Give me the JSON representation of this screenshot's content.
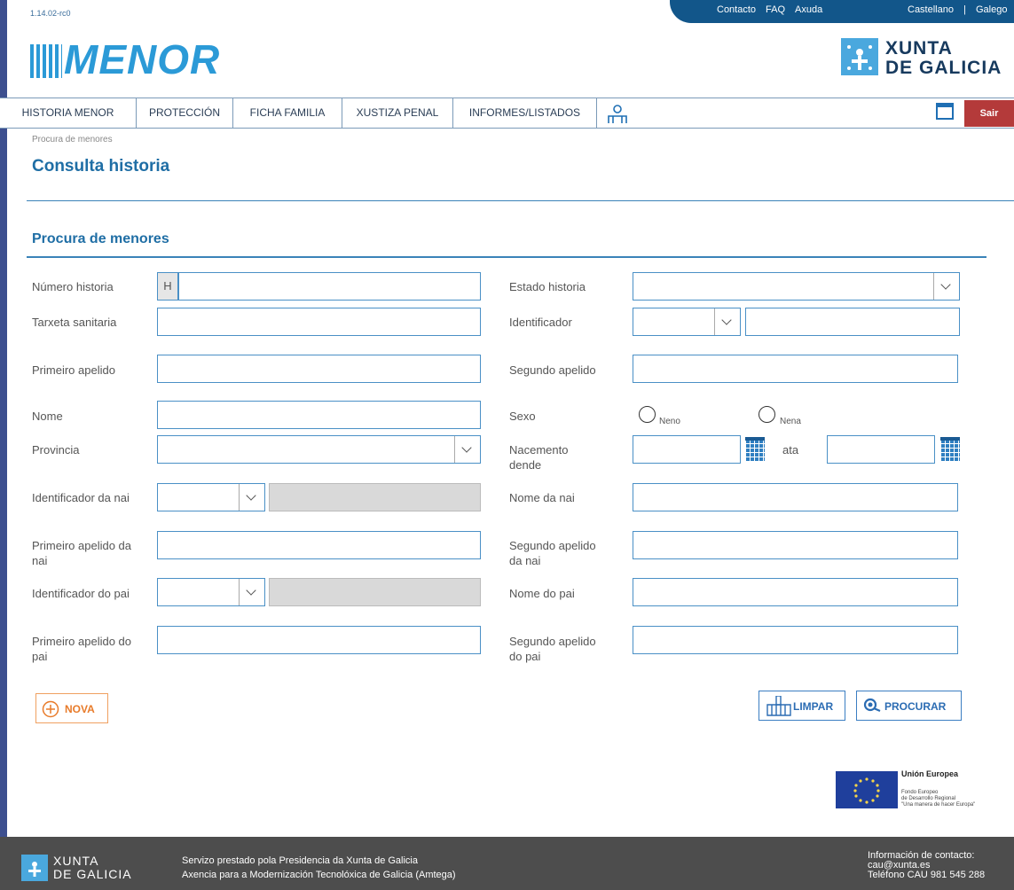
{
  "version": "1.14.02-rc0",
  "toplinks": {
    "contacto": "Contacto",
    "faq": "FAQ",
    "axuda": "Axuda",
    "castellano": "Castellano",
    "sep": "|",
    "galego": "Galego"
  },
  "app_logo": "MENOR",
  "brand": {
    "line1": "XUNTA",
    "line2": "DE GALICIA"
  },
  "nav": {
    "items": [
      "HISTORIA MENOR",
      "PROTECCIÓN",
      "FICHA FAMILIA",
      "XUSTIZA PENAL",
      "INFORMES/LISTADOS"
    ],
    "sair": "Sair"
  },
  "breadcrumb": "Procura de menores",
  "page_title": "Consulta historia",
  "section_title": "Procura de menores",
  "form": {
    "numero_historia": {
      "label": "Número historia",
      "prefix": "H",
      "value": ""
    },
    "estado_historia": {
      "label": "Estado historia",
      "value": ""
    },
    "tarxeta": {
      "label": "Tarxeta sanitaria",
      "value": ""
    },
    "identificador": {
      "label": "Identificador",
      "type_value": "",
      "value": ""
    },
    "primeiro_apelido": {
      "label": "Primeiro apelido",
      "value": ""
    },
    "segundo_apelido": {
      "label": "Segundo apelido",
      "value": ""
    },
    "nome": {
      "label": "Nome",
      "value": ""
    },
    "sexo": {
      "label": "Sexo",
      "options": [
        "Neno",
        "Nena"
      ]
    },
    "provincia": {
      "label": "Provincia",
      "value": ""
    },
    "nacemento": {
      "label": "Nacemento dende",
      "ata": "ata",
      "from": "",
      "to": ""
    },
    "identificador_nai": {
      "label": "Identificador da nai"
    },
    "nome_nai": {
      "label": "Nome da nai",
      "value": ""
    },
    "primeiro_apelido_nai": {
      "label": "Primeiro apelido da nai",
      "value": ""
    },
    "segundo_apelido_nai": {
      "label": "Segundo apelido da nai",
      "value": ""
    },
    "identificador_pai": {
      "label": "Identificador do pai"
    },
    "nome_pai": {
      "label": "Nome do pai",
      "value": ""
    },
    "primeiro_apelido_pai": {
      "label": "Primeiro apelido do pai",
      "value": ""
    },
    "segundo_apelido_pai": {
      "label": "Segundo apelido do pai",
      "value": ""
    }
  },
  "buttons": {
    "nova": "NOVA",
    "limpar": "LIMPAR",
    "procurar": "PROCURAR"
  },
  "eu": {
    "title": "Unión Europea",
    "line1": "Fondo Europeo",
    "line2": "de Desarrollo Regional",
    "line3": "\"Una manera de hacer Europa\""
  },
  "footer": {
    "service1": "Servizo prestado pola Presidencia da Xunta de Galicia",
    "service2": "Axencia para a Modernización Tecnolóxica de Galicia (Amtega)",
    "contact1": "Información de contacto:",
    "contact2": "cau@xunta.es",
    "contact3": "Teléfono CAU 981 545 288"
  },
  "colors": {
    "accent": "#1f6ea5",
    "topbar": "#12568a",
    "sair": "#b43a3a",
    "footer": "#4d4d4d"
  }
}
